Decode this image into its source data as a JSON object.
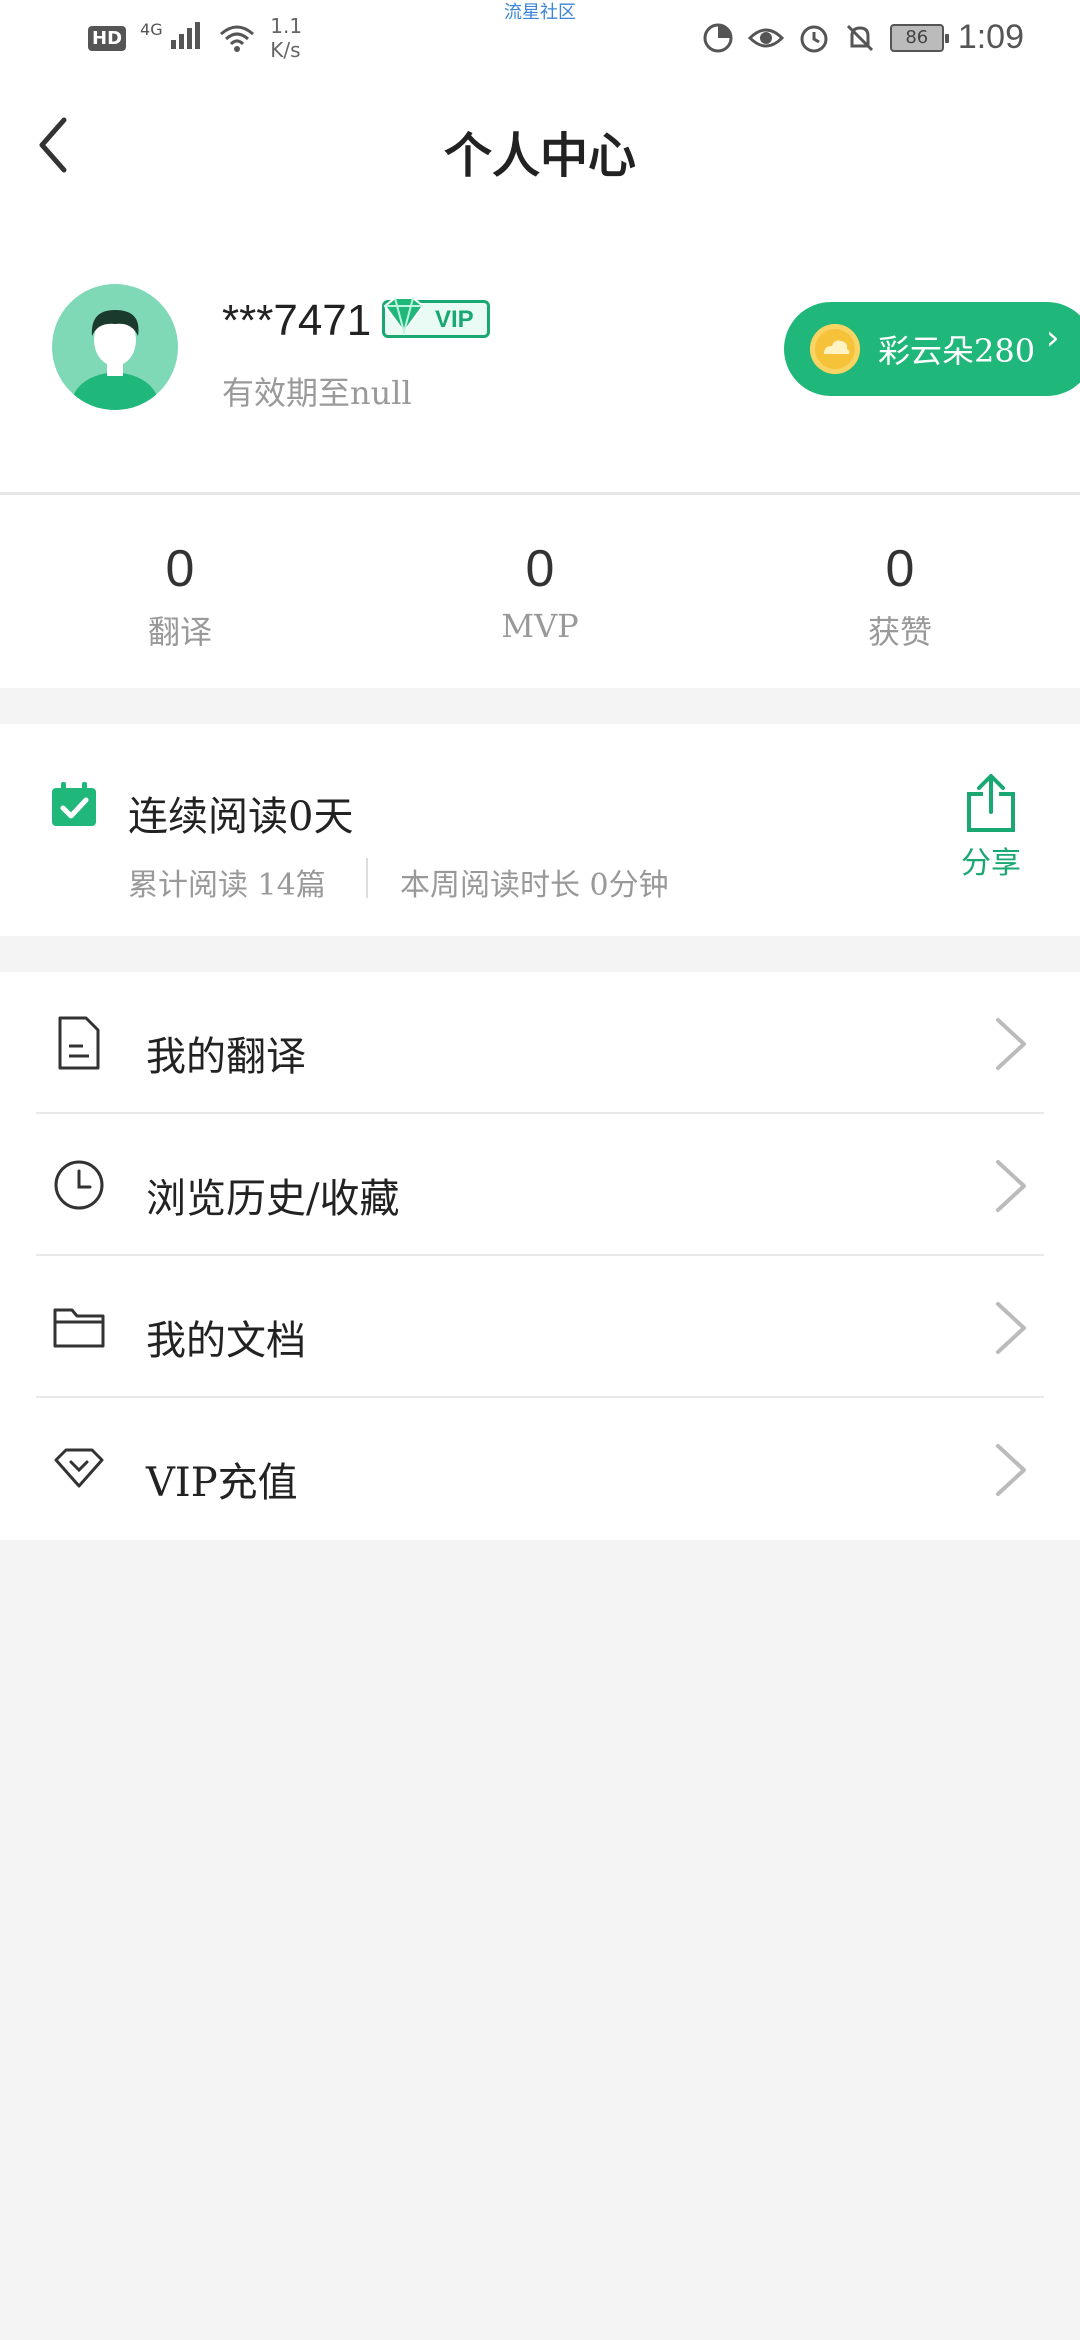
{
  "status_bar": {
    "hd": "HD",
    "network_type": "4G",
    "speed_value": "1.1",
    "speed_unit": "K/s",
    "carrier_note": "流星社区",
    "battery": "86",
    "time": "1:09"
  },
  "header": {
    "title": "个人中心"
  },
  "profile": {
    "username": "***7471",
    "vip_label": "VIP",
    "expiry": "有效期至null",
    "coins": "彩云朵280",
    "chevron": "›"
  },
  "stats": [
    {
      "value": "0",
      "label": "翻译"
    },
    {
      "value": "0",
      "label": "MVP"
    },
    {
      "value": "0",
      "label": "获赞"
    }
  ],
  "reading": {
    "streak": "连续阅读0天",
    "cumulative": "累计阅读 14篇",
    "weekly": "本周阅读时长 0分钟",
    "share_label": "分享"
  },
  "menu": [
    {
      "label": "我的翻译",
      "icon": "document-icon"
    },
    {
      "label": "浏览历史/收藏",
      "icon": "clock-icon"
    },
    {
      "label": "我的文档",
      "icon": "folder-icon"
    },
    {
      "label": "VIP充值",
      "icon": "diamond-icon"
    }
  ],
  "colors": {
    "accent": "#1aa872",
    "accent_fill": "#1fb77a",
    "background": "#f4f4f4"
  }
}
